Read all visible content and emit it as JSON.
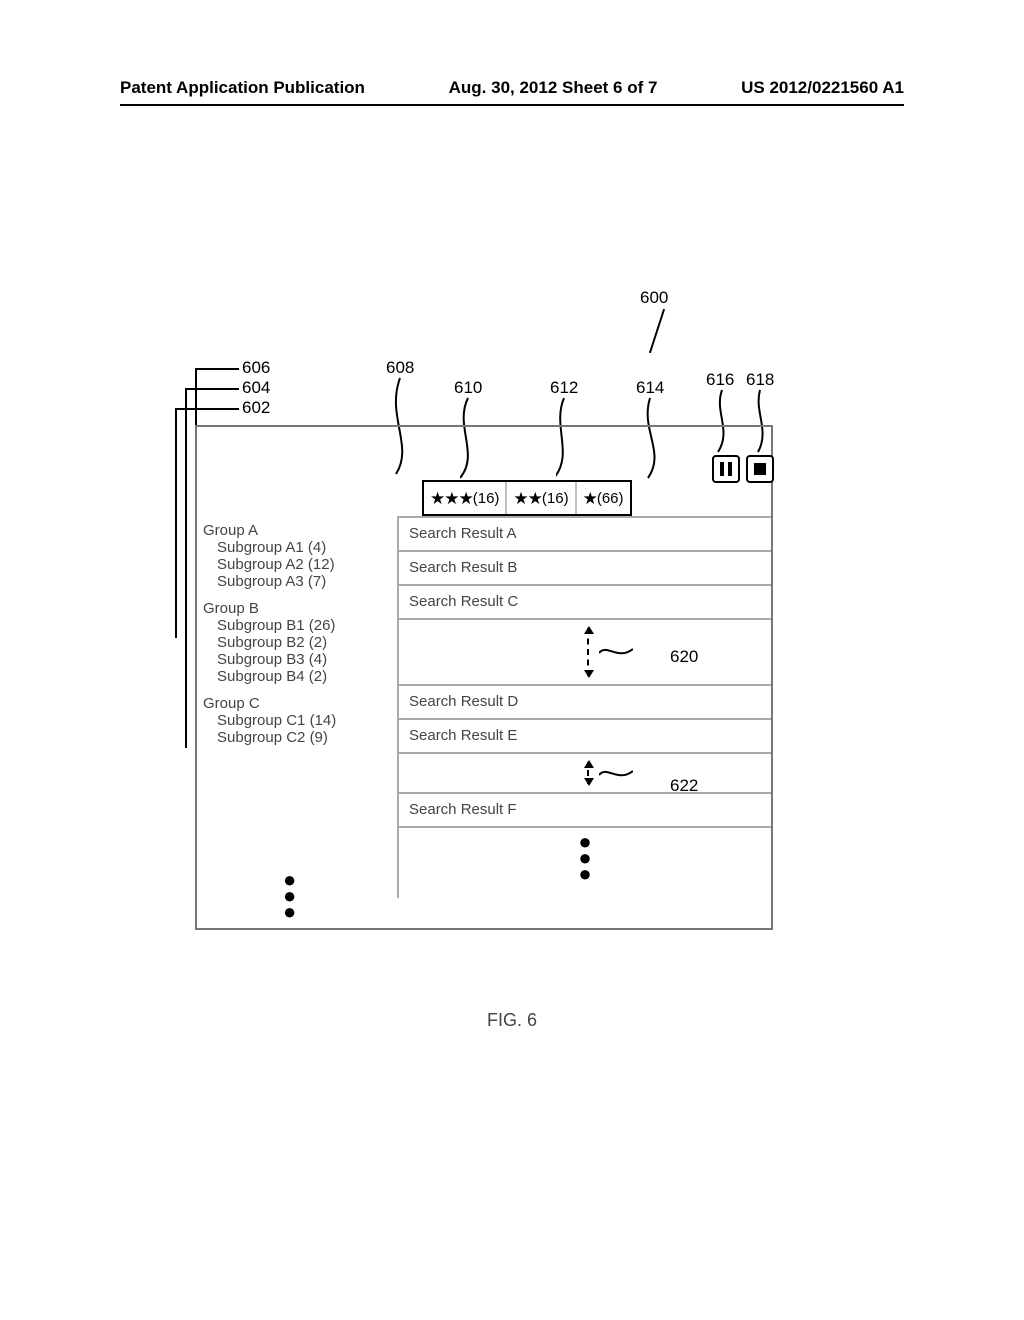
{
  "header": {
    "left": "Patent Application Publication",
    "center": "Aug. 30, 2012  Sheet 6 of 7",
    "right": "US 2012/0221560 A1"
  },
  "ref": {
    "n600": "600",
    "n602": "602",
    "n604": "604",
    "n606": "606",
    "n608": "608",
    "n610": "610",
    "n612": "612",
    "n614": "614",
    "n616": "616",
    "n618": "618",
    "n620": "620",
    "n622": "622"
  },
  "tabs": {
    "t3": {
      "stars": "★★★",
      "count": "(16)"
    },
    "t2": {
      "stars": "★★",
      "count": "(16)"
    },
    "t1": {
      "stars": "★",
      "count": "(66)"
    }
  },
  "sidebar": {
    "groups": [
      {
        "label": "Group A",
        "subs": [
          "Subgroup A1 (4)",
          "Subgroup A2 (12)",
          "Subgroup A3 (7)"
        ]
      },
      {
        "label": "Group B",
        "subs": [
          "Subgroup B1 (26)",
          "Subgroup B2 (2)",
          "Subgroup B3 (4)",
          "Subgroup B4 (2)"
        ]
      },
      {
        "label": "Group C",
        "subs": [
          "Subgroup C1 (14)",
          "Subgroup C2 (9)"
        ]
      }
    ]
  },
  "results": {
    "a": "Search Result A",
    "b": "Search Result B",
    "c": "Search Result C",
    "d": "Search Result D",
    "e": "Search Result E",
    "f": "Search Result F"
  },
  "figure_caption": "FIG. 6"
}
